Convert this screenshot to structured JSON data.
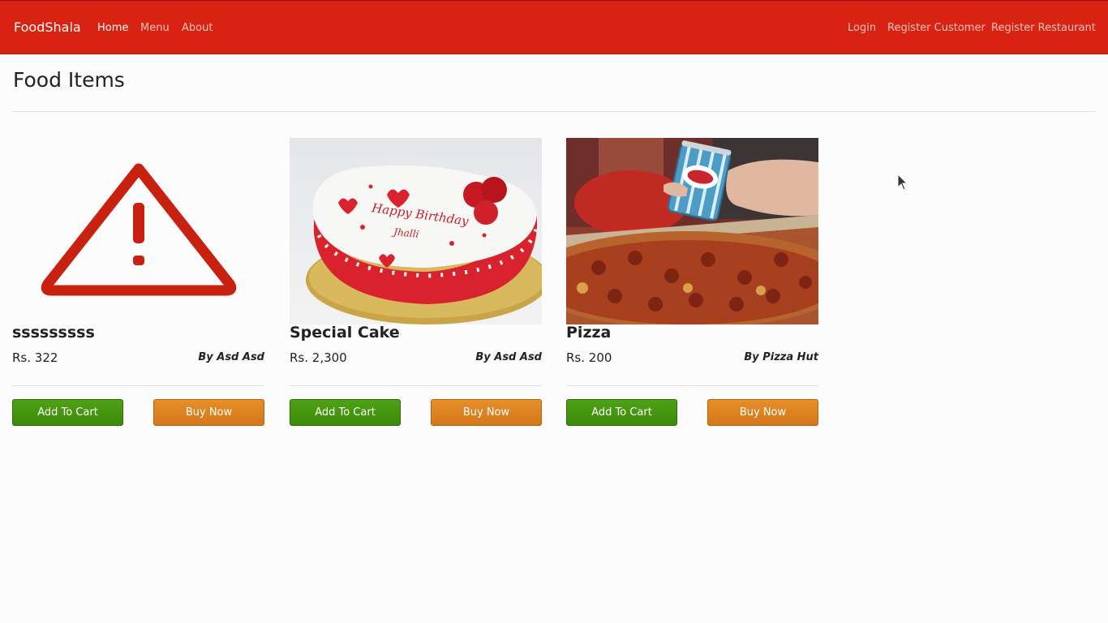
{
  "navbar": {
    "brand": "FoodShala",
    "left_links": [
      "Home",
      "Menu",
      "About"
    ],
    "right_links": [
      "Login",
      "Register Customer",
      "Register Restaurant"
    ],
    "active": "Home",
    "color": "#d92312"
  },
  "page": {
    "title": "Food Items"
  },
  "items": [
    {
      "name": "sssssssss",
      "price": "Rs. 322",
      "by": "By Asd Asd",
      "image": "warning-triangle-icon",
      "add_label": "Add To Cart",
      "buy_label": "Buy Now"
    },
    {
      "name": "Special Cake",
      "price": "Rs. 2,300",
      "by": "By Asd Asd",
      "image": "birthday-cake-photo",
      "cake_text_1": "Happy Birthday",
      "cake_text_2": "Jhalli",
      "add_label": "Add To Cart",
      "buy_label": "Buy Now"
    },
    {
      "name": "Pizza",
      "price": "Rs. 200",
      "by": "By Pizza Hut",
      "image": "pizza-and-soda-photo",
      "add_label": "Add To Cart",
      "buy_label": "Buy Now"
    }
  ],
  "colors": {
    "add_to_cart": "#45961a",
    "buy_now": "#dc8424"
  }
}
